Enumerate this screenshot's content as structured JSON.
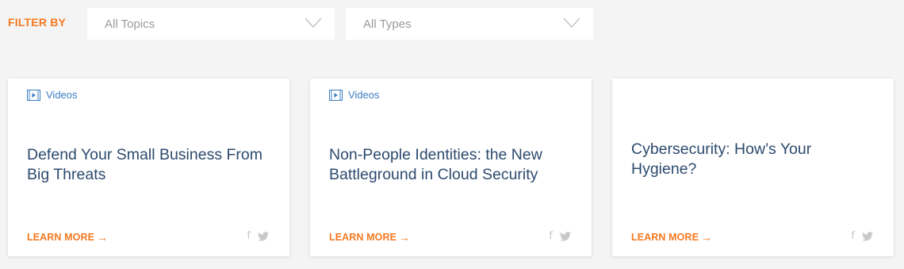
{
  "filter": {
    "label": "FILTER BY",
    "topics": {
      "selected": "All Topics",
      "icon": "chevron-down-icon"
    },
    "types": {
      "selected": "All Types",
      "icon": "chevron-down-icon"
    }
  },
  "colors": {
    "accent": "#f47920",
    "link_blue": "#3b7fc4",
    "title": "#2c4a6e",
    "social": "#c9c9c9",
    "background": "#f4f4f4"
  },
  "cards": [
    {
      "type_label": "Videos",
      "type_icon": "video-icon",
      "title": "Defend Your Small Business From Big Threats",
      "cta": "LEARN MORE",
      "cta_arrow": "→",
      "social": [
        "facebook-icon",
        "twitter-icon"
      ],
      "fb_glyph": "f"
    },
    {
      "type_label": "Videos",
      "type_icon": "video-icon",
      "title": "Non-People Identities: the New Battleground in Cloud Security",
      "cta": "LEARN MORE",
      "cta_arrow": "→",
      "social": [
        "facebook-icon",
        "twitter-icon"
      ],
      "fb_glyph": "f"
    },
    {
      "type_label": "",
      "type_icon": "",
      "title": "Cybersecurity: How’s Your Hygiene?",
      "cta": "LEARN MORE",
      "cta_arrow": "→",
      "social": [
        "facebook-icon",
        "twitter-icon"
      ],
      "fb_glyph": "f"
    }
  ]
}
